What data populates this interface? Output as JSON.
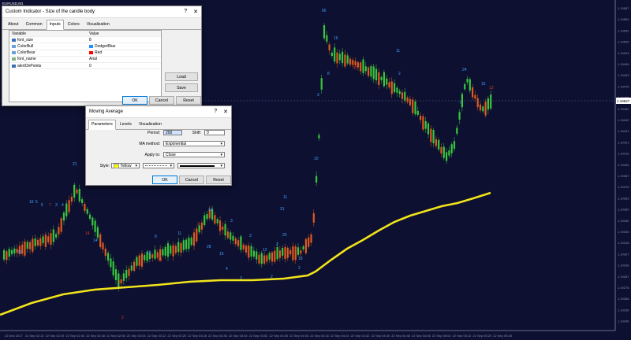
{
  "chart": {
    "symbol": "EURUSD,M1",
    "colors": {
      "bg": "#0d1030",
      "bull": "#39c83c",
      "bear": "#e05a1e",
      "ma": "#f2e41a",
      "label": "#3fa0ff",
      "labelBear": "#e0391e",
      "axis": "#8a8fb0",
      "current": "#ffffff"
    },
    "price_labels": [
      "1.19587",
      "1.19552",
      "1.19542",
      "1.19525",
      "1.19513",
      "1.19499",
      "1.19493",
      "1.19476",
      "1.19466",
      "1.19452",
      "1.19442",
      "1.19431",
      "1.19421",
      "1.19410",
      "1.19400",
      "1.19387",
      "1.19375",
      "1.19363",
      "1.19350",
      "1.19340",
      "1.19330",
      "1.19318",
      "1.19307",
      "1.19298",
      "1.19287",
      "1.19276",
      "1.19266",
      "1.19256",
      "1.19246"
    ],
    "time_labels": [
      "22 Dec 2017",
      "22 Sep 02:10",
      "22 Sep 02:29",
      "22 Sep 02:40",
      "22 Sep 02:48",
      "22 Sep 02:56",
      "22 Sep 03:04",
      "22 Sep 03:12",
      "22 Sep 03:20",
      "22 Sep 03:28",
      "22 Sep 03:36",
      "22 Sep 03:44",
      "22 Sep 03:52",
      "22 Sep 04:00",
      "22 Sep 04:08",
      "22 Sep 04:16",
      "22 Sep 04:24",
      "22 Sep 04:32",
      "22 Sep 04:40",
      "22 Sep 04:48",
      "22 Sep 04:56",
      "22 Sep 05:04",
      "22 Sep 05:12",
      "22 Sep 05:20",
      "22 Sep 05:28"
    ],
    "current_price": "1.19527",
    "bar_labels": [
      "66",
      "16",
      "3",
      "8",
      "17",
      "11",
      "2",
      "24",
      "15",
      "13",
      "21",
      "5",
      "10",
      "5",
      "7",
      "3",
      "2",
      "11",
      "25",
      "14",
      "14",
      "13",
      "11",
      "19",
      "16",
      "4",
      "3",
      "12",
      "2",
      "14",
      "3",
      "2",
      "31",
      "28",
      "2",
      "35",
      "16",
      "4",
      "8",
      "3",
      "15",
      "3",
      "18",
      "7"
    ]
  },
  "indicator_dialog": {
    "title": "Custom Indicator - Size of the candle body",
    "tabs": [
      "About",
      "Common",
      "Inputs",
      "Colors",
      "Visualization"
    ],
    "active_tab": "Inputs",
    "columns": {
      "variable": "Variable",
      "value": "Value"
    },
    "rows": [
      {
        "name": "font_size",
        "value": "8",
        "icon": "int-icon",
        "swatch": ""
      },
      {
        "name": "ColorBull",
        "value": "DodgerBlue",
        "icon": "color-icon",
        "swatch": "#1e90ff"
      },
      {
        "name": "ColorBear",
        "value": "Red",
        "icon": "color-icon",
        "swatch": "#ff0000"
      },
      {
        "name": "font_name",
        "value": "Arial",
        "icon": "string-icon",
        "swatch": ""
      },
      {
        "name": "alertOnPoints",
        "value": "0",
        "icon": "int-icon",
        "swatch": ""
      }
    ],
    "load_label": "Load",
    "save_label": "Save",
    "ok_label": "OK",
    "cancel_label": "Cancel",
    "reset_label": "Reset",
    "help_glyph": "?",
    "close_glyph": "✕"
  },
  "ma_dialog": {
    "title": "Moving Average",
    "tabs": [
      "Parameters",
      "Levels",
      "Visualization"
    ],
    "active_tab": "Parameters",
    "period_label": "Period:",
    "period_value": "200",
    "shift_label": "Shift:",
    "shift_value": "0",
    "method_label": "MA method:",
    "method_value": "Exponential",
    "apply_label": "Apply to:",
    "apply_value": "Close",
    "style_label": "Style:",
    "style_color_name": "Yellow",
    "style_color": "#ffff00",
    "ok_label": "OK",
    "cancel_label": "Cancel",
    "reset_label": "Reset",
    "help_glyph": "?",
    "close_glyph": "✕"
  }
}
